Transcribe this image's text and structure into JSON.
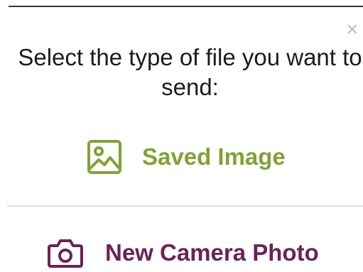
{
  "dialog": {
    "close_glyph": "×",
    "prompt": "Select the type of file you want to send:",
    "options": [
      {
        "label": "Saved Image",
        "icon": "image-icon",
        "color": "#7fa334"
      },
      {
        "label": "New Camera Photo",
        "icon": "camera-icon",
        "color": "#6b2358"
      }
    ]
  }
}
